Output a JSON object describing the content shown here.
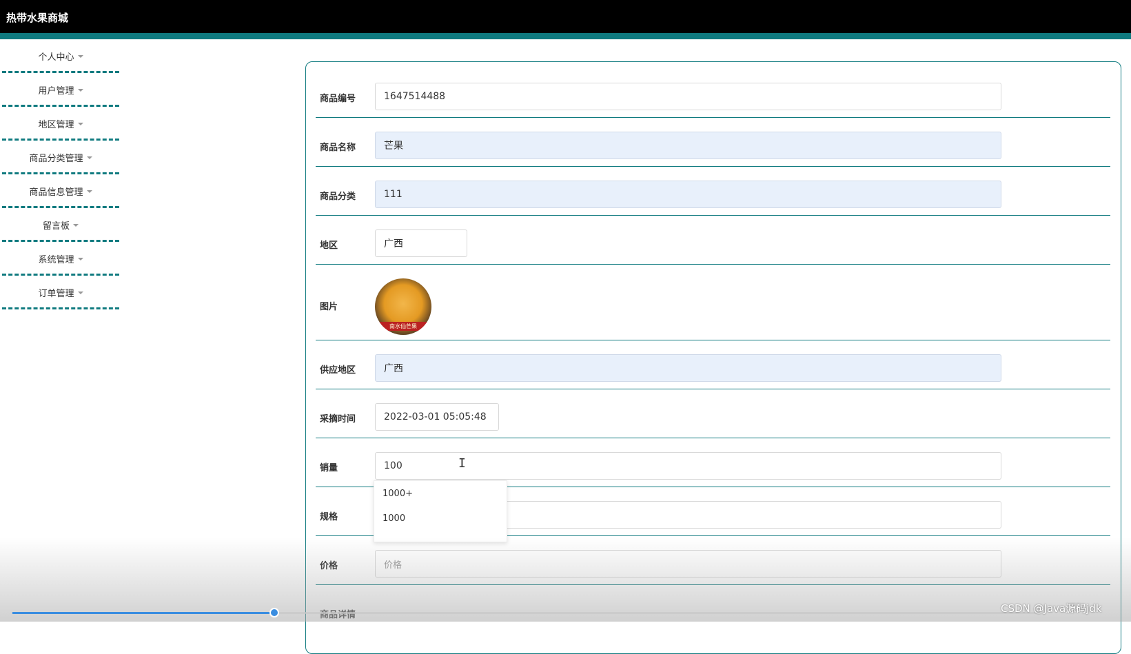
{
  "app": {
    "title": "热带水果商城"
  },
  "sidebar": {
    "items": [
      {
        "label": "个人中心"
      },
      {
        "label": "用户管理"
      },
      {
        "label": "地区管理"
      },
      {
        "label": "商品分类管理"
      },
      {
        "label": "商品信息管理"
      },
      {
        "label": "留言板"
      },
      {
        "label": "系统管理"
      },
      {
        "label": "订单管理"
      }
    ]
  },
  "form": {
    "product_no": {
      "label": "商品编号",
      "value": "1647514488"
    },
    "product_name": {
      "label": "商品名称",
      "value": "芒果"
    },
    "category": {
      "label": "商品分类",
      "value": "111"
    },
    "region": {
      "label": "地区",
      "value": "广西"
    },
    "image": {
      "label": "图片",
      "caption": "南水仙芒果"
    },
    "supply_region": {
      "label": "供应地区",
      "value": "广西"
    },
    "pick_time": {
      "label": "采摘时间",
      "value": "2022-03-01 05:05:48"
    },
    "sales": {
      "label": "销量",
      "value": "100"
    },
    "spec": {
      "label": "规格",
      "value": ""
    },
    "price": {
      "label": "价格",
      "placeholder": "价格"
    },
    "details": {
      "label": "商品详情"
    }
  },
  "autocomplete": {
    "options": [
      "1000+",
      "1000"
    ]
  },
  "video": {
    "progress": 0.255
  },
  "watermark": "CSDN @Java源码jdk",
  "colors": {
    "accent": "#0f7a7f",
    "topbar": "#000000",
    "filled_input": "#e8f0fb",
    "progress": "#3a8de0"
  }
}
